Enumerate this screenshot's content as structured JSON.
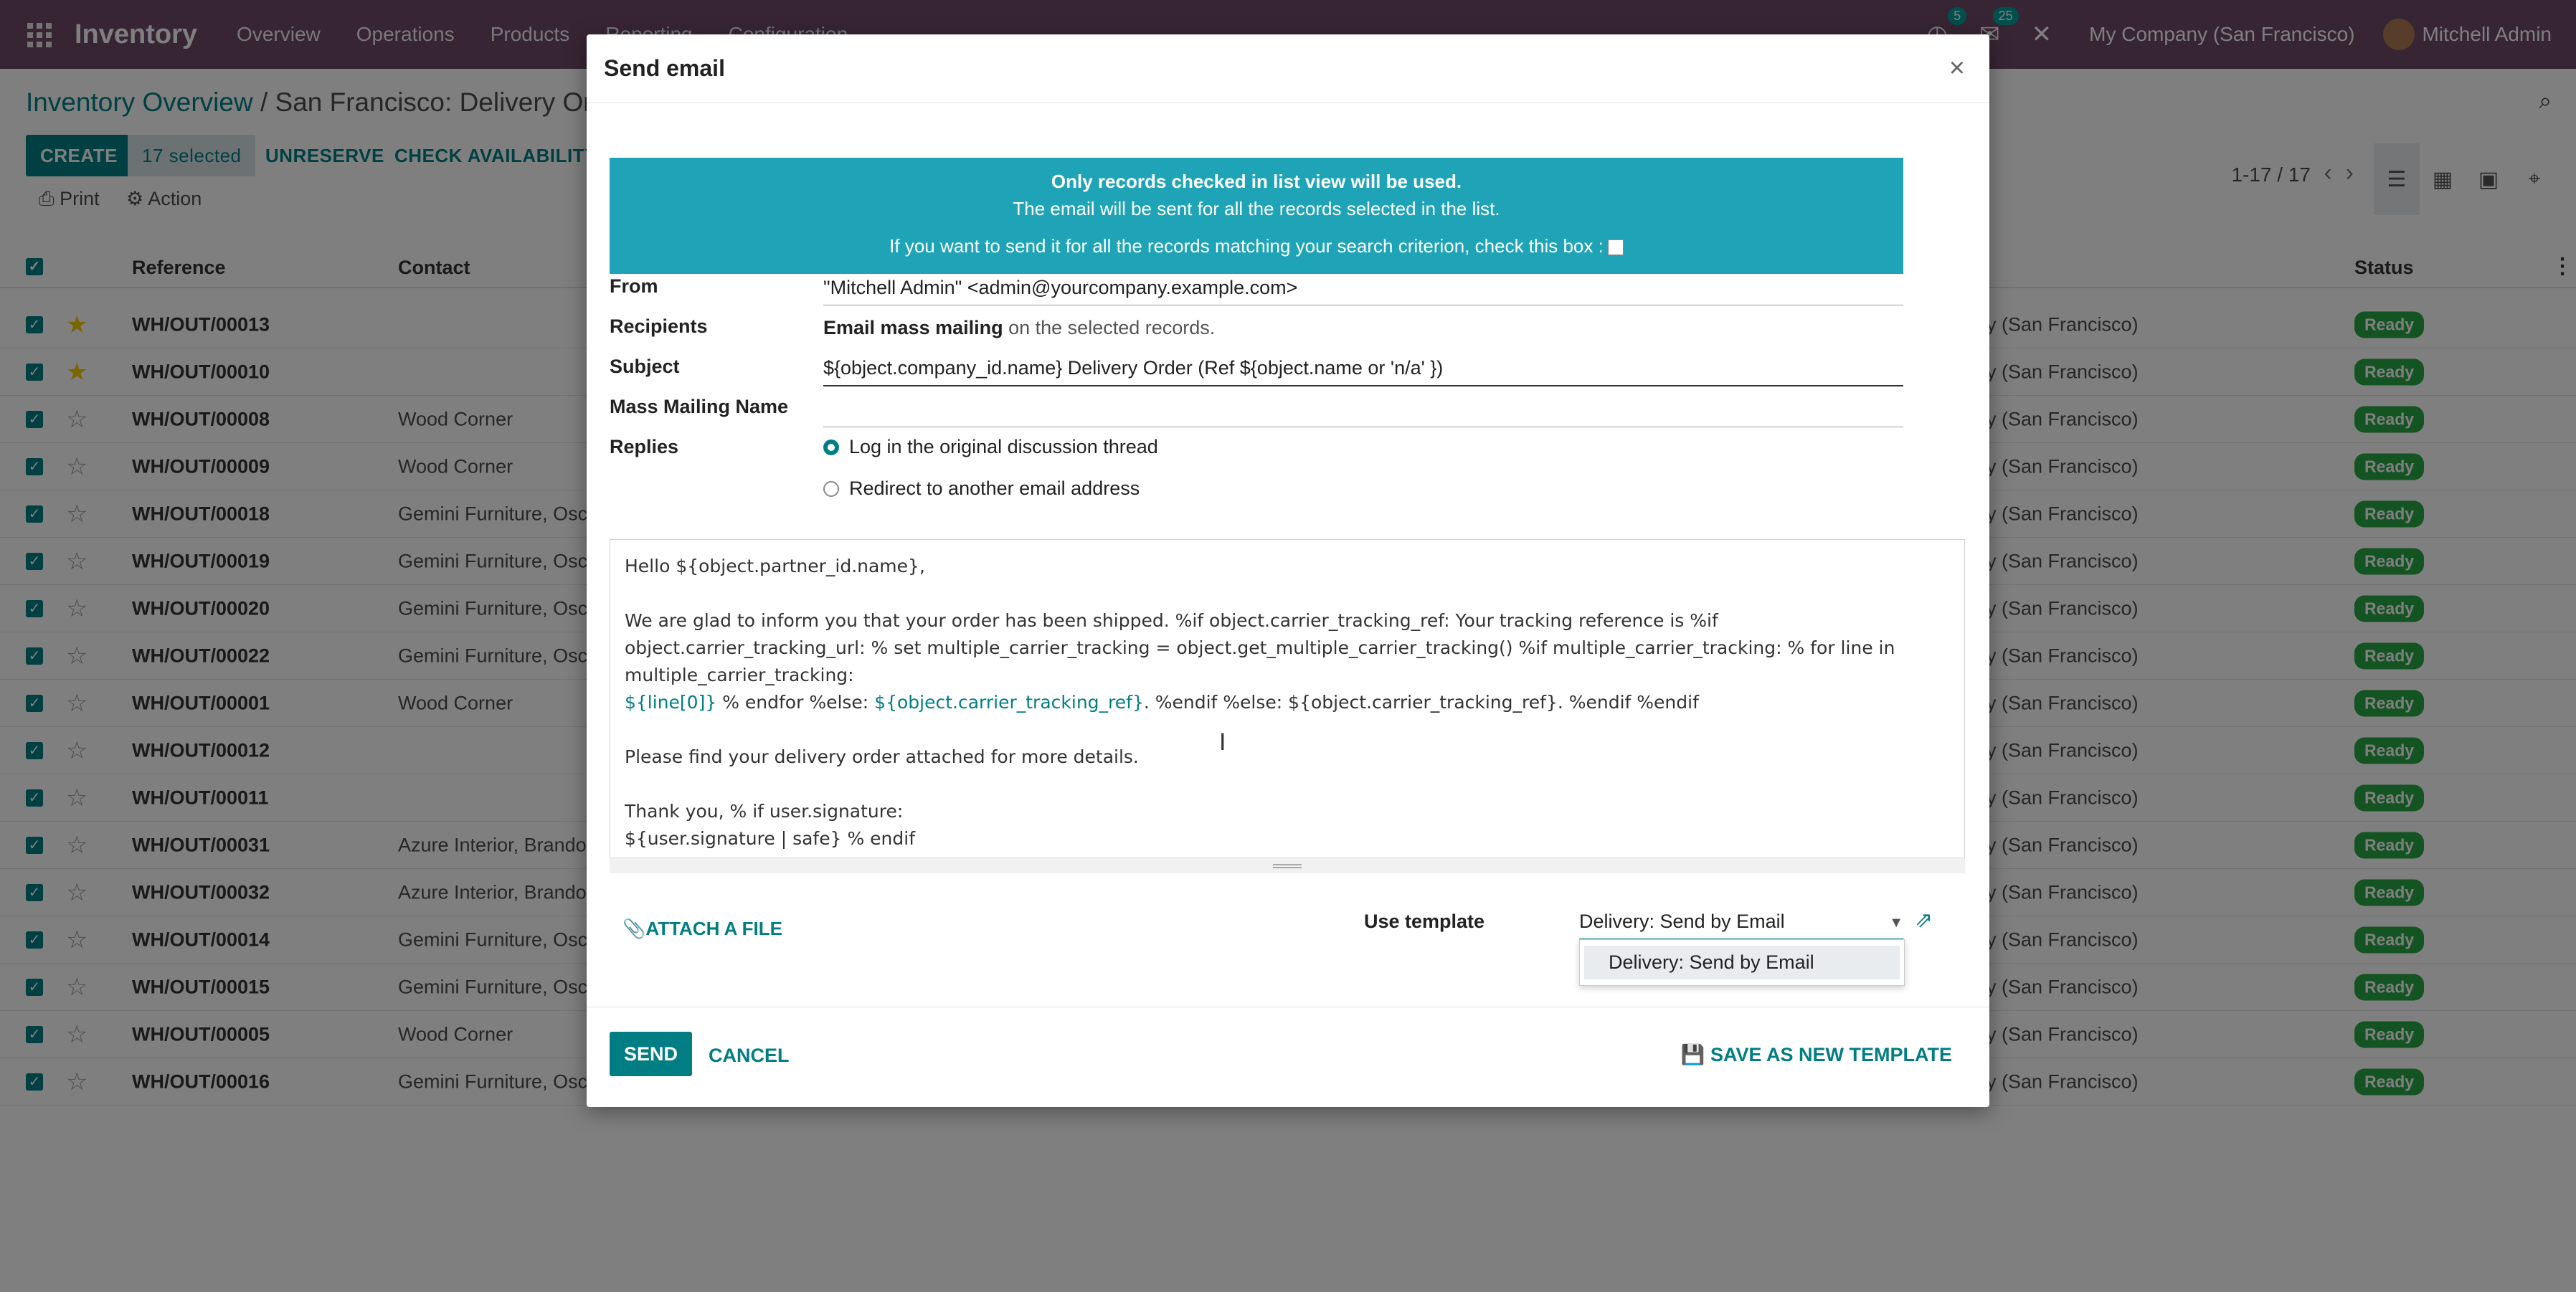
{
  "navbar": {
    "app_name": "Inventory",
    "menu": [
      "Overview",
      "Operations",
      "Products",
      "Reporting",
      "Configuration"
    ],
    "activity_count": "5",
    "message_count": "25",
    "company": "My Company (San Francisco)",
    "user": "Mitchell Admin"
  },
  "control": {
    "breadcrumb_parent": "Inventory Overview",
    "breadcrumb_sep": " / ",
    "breadcrumb_current": "San Francisco: Delivery Orders",
    "create": "CREATE",
    "selected": "17 selected",
    "unreserve": "UNRESERVE",
    "check_availability": "CHECK AVAILABILITY",
    "print": "Print",
    "action": "Action",
    "pager": "1-17 / 17"
  },
  "list": {
    "headers": {
      "reference": "Reference",
      "contact": "Contact",
      "status": "Status"
    },
    "rows": [
      {
        "ref": "WH/OUT/00013",
        "contact": "",
        "loc": "y (San Francisco)",
        "status": "Ready",
        "starred": true
      },
      {
        "ref": "WH/OUT/00010",
        "contact": "",
        "loc": "y (San Francisco)",
        "status": "Ready",
        "starred": true
      },
      {
        "ref": "WH/OUT/00008",
        "contact": "Wood Corner",
        "loc": "y (San Francisco)",
        "status": "Ready",
        "starred": false
      },
      {
        "ref": "WH/OUT/00009",
        "contact": "Wood Corner",
        "loc": "y (San Francisco)",
        "status": "Ready",
        "starred": false
      },
      {
        "ref": "WH/OUT/00018",
        "contact": "Gemini Furniture, Osca",
        "loc": "y (San Francisco)",
        "status": "Ready",
        "starred": false
      },
      {
        "ref": "WH/OUT/00019",
        "contact": "Gemini Furniture, Osca",
        "loc": "y (San Francisco)",
        "status": "Ready",
        "starred": false
      },
      {
        "ref": "WH/OUT/00020",
        "contact": "Gemini Furniture, Osca",
        "loc": "y (San Francisco)",
        "status": "Ready",
        "starred": false
      },
      {
        "ref": "WH/OUT/00022",
        "contact": "Gemini Furniture, Osca",
        "loc": "y (San Francisco)",
        "status": "Ready",
        "starred": false
      },
      {
        "ref": "WH/OUT/00001",
        "contact": "Wood Corner",
        "loc": "y (San Francisco)",
        "status": "Ready",
        "starred": false
      },
      {
        "ref": "WH/OUT/00012",
        "contact": "",
        "loc": "y (San Francisco)",
        "status": "Ready",
        "starred": false
      },
      {
        "ref": "WH/OUT/00011",
        "contact": "",
        "loc": "y (San Francisco)",
        "status": "Ready",
        "starred": false
      },
      {
        "ref": "WH/OUT/00031",
        "contact": "Azure Interior, Brandon",
        "loc": "y (San Francisco)",
        "status": "Ready",
        "starred": false
      },
      {
        "ref": "WH/OUT/00032",
        "contact": "Azure Interior, Brandon",
        "loc": "y (San Francisco)",
        "status": "Ready",
        "starred": false
      },
      {
        "ref": "WH/OUT/00014",
        "contact": "Gemini Furniture, Osca",
        "loc": "y (San Francisco)",
        "status": "Ready",
        "starred": false
      },
      {
        "ref": "WH/OUT/00015",
        "contact": "Gemini Furniture, Osca",
        "loc": "y (San Francisco)",
        "status": "Ready",
        "starred": false
      },
      {
        "ref": "WH/OUT/00005",
        "contact": "Wood Corner",
        "loc": "y (San Francisco)",
        "status": "Ready",
        "starred": false
      },
      {
        "ref": "WH/OUT/00016",
        "contact": "Gemini Furniture, Osca",
        "loc": "y (San Francisco)",
        "status": "Ready",
        "starred": false
      }
    ]
  },
  "dialog": {
    "title": "Send email",
    "close": "×",
    "alert_line1": "Only records checked in list view will be used.",
    "alert_line2": "The email will be sent for all the records selected in the list.",
    "alert_line3": "If you want to send it for all the records matching your search criterion, check this box :",
    "from_label": "From",
    "from_value": "\"Mitchell Admin\" <admin@yourcompany.example.com>",
    "recipients_label": "Recipients",
    "recipients_bold": "Email mass mailing",
    "recipients_rest": " on the selected records.",
    "subject_label": "Subject",
    "subject_value": "${object.company_id.name} Delivery Order (Ref ${object.name or 'n/a' })",
    "mass_name_label": "Mass Mailing Name",
    "mass_name_value": "",
    "replies_label": "Replies",
    "reply_option1": "Log in the original discussion thread",
    "reply_option2": "Redirect to another email address",
    "body": {
      "l1": "Hello ${object.partner_id.name},",
      "l2": "We are glad to inform you that your order has been shipped. %if object.carrier_tracking_ref: Your tracking reference is %if",
      "l3": "object.carrier_tracking_url: % set multiple_carrier_tracking = object.get_multiple_carrier_tracking() %if multiple_carrier_tracking: % for line in",
      "l4": "multiple_carrier_tracking:",
      "l5a": "${line[0]}",
      "l5b": " % endfor %else: ",
      "l5c": "${object.carrier_tracking_ref}",
      "l5d": ". %endif %else: ${object.carrier_tracking_ref}. %endif %endif",
      "l6": "Please find your delivery order attached for more details.",
      "l7": "Thank you, % if user.signature:",
      "l8": "${user.signature | safe} % endif"
    },
    "attach": "ATTACH A FILE",
    "template_label": "Use template",
    "template_value": "Delivery: Send by Email",
    "template_option": "Delivery: Send by Email",
    "send": "SEND",
    "cancel": "CANCEL",
    "save_template": "SAVE AS NEW TEMPLATE"
  }
}
